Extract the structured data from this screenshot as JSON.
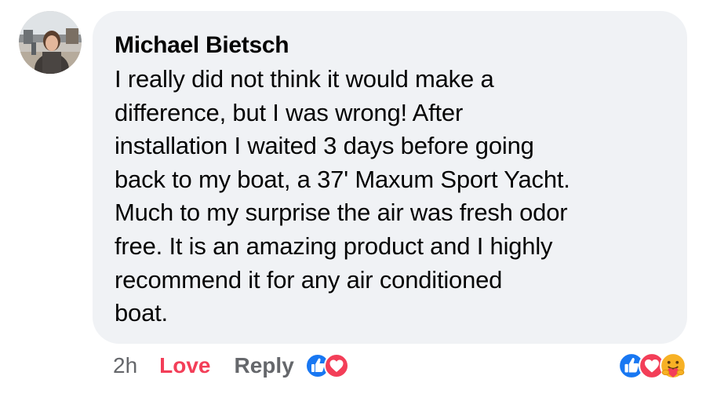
{
  "comment": {
    "author": "Michael Bietsch",
    "text": "I really did not think it would make a\ndifference, but I was wrong! After\ninstallation I waited 3 days before going\nback to my boat, a 37' Maxum Sport Yacht.\nMuch to my surprise the air was fresh  odor\nfree. It is an amazing product and I highly\nrecommend it for any air conditioned\nboat.",
    "avatar_icon": "profile-photo"
  },
  "actions": {
    "time": "2h",
    "love_label": "Love",
    "reply_label": "Reply",
    "inline_reactions": [
      "like-icon",
      "love-icon"
    ],
    "summary_reactions": [
      "like-icon",
      "love-icon",
      "care-icon"
    ]
  },
  "colors": {
    "bubble": "#f0f2f5",
    "text": "#050505",
    "muted": "#65676b",
    "love": "#f33e58",
    "like": "#1877f2",
    "care": "#f7b125"
  }
}
